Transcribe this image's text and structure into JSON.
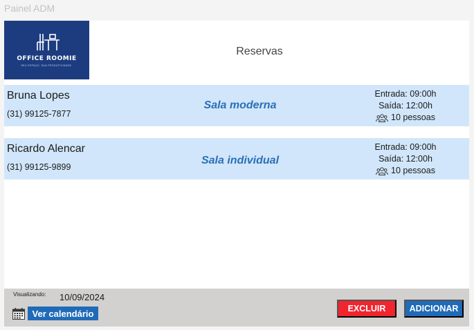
{
  "app": {
    "title": "Painel ADM"
  },
  "logo": {
    "name": "OFFICE ROOMIE",
    "tagline": "SEU ESPAÇO. SUA PRODUTIVIDADE."
  },
  "page": {
    "title": "Reservas"
  },
  "reservations": [
    {
      "name": "Bruna Lopes",
      "phone": "(31) 99125-7877",
      "room": "Sala moderna",
      "entry": "Entrada: 09:00h",
      "exit": "Saída: 12:00h",
      "people": "10 pessoas"
    },
    {
      "name": "Ricardo Alencar",
      "phone": "(31) 99125-9899",
      "room": "Sala individual",
      "entry": "Entrada: 09:00h",
      "exit": "Saída: 12:00h",
      "people": "10 pessoas"
    }
  ],
  "footer": {
    "viewing_label": "Visualizando:",
    "viewing_date": "10/09/2024",
    "calendar_button": "Ver calendário",
    "delete_button": "EXCLUIR",
    "add_button": "ADICIONAR"
  },
  "colors": {
    "brand_navy": "#1d3c80",
    "row_highlight": "#d1e6fa",
    "room_text": "#2a6fb8",
    "primary_button": "#1f6bb8",
    "danger_button": "#f0252d",
    "footer_bg": "#d2d1cf"
  },
  "icons": [
    "office-desk-logo-icon",
    "people-icon",
    "calendar-icon"
  ]
}
